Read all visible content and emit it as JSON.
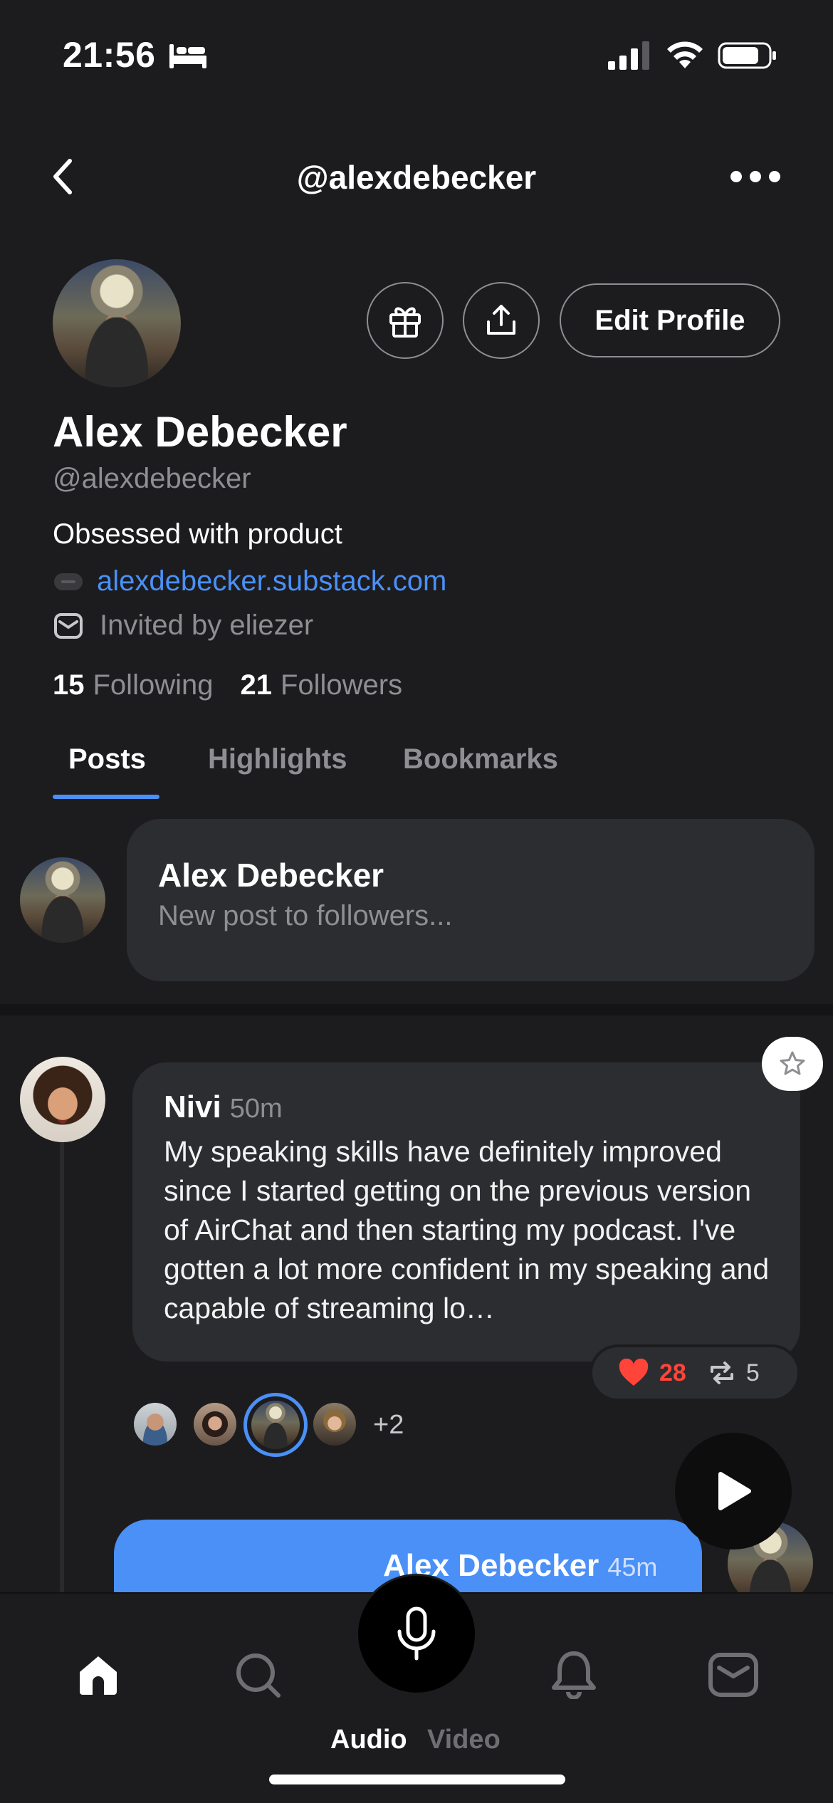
{
  "status_bar": {
    "time": "21:56"
  },
  "header": {
    "title": "@alexdebecker"
  },
  "profile": {
    "edit_label": "Edit Profile",
    "name": "Alex Debecker",
    "handle": "@alexdebecker",
    "bio": "Obsessed with product",
    "link": "alexdebecker.substack.com",
    "invited_by": "Invited by eliezer",
    "following_count": "15",
    "following_label": "Following",
    "followers_count": "21",
    "followers_label": "Followers"
  },
  "tabs": [
    {
      "label": "Posts",
      "active": true
    },
    {
      "label": "Highlights",
      "active": false
    },
    {
      "label": "Bookmarks",
      "active": false
    }
  ],
  "composer": {
    "name": "Alex Debecker",
    "placeholder": "New post to followers..."
  },
  "post": {
    "author": "Nivi",
    "time": "50m",
    "text": "My speaking skills have definitely improved since I started getting on the previous version of AirChat and then starting my podcast. I've gotten a lot more confident in my speaking and capable of streaming lo…",
    "likes": "28",
    "reposts": "5",
    "more_listeners": "+2"
  },
  "next_post": {
    "author": "Alex Debecker",
    "time": "45m"
  },
  "bottom_nav": {
    "audio_label": "Audio",
    "video_label": "Video"
  },
  "colors": {
    "accent": "#4a90f7",
    "like": "#ff453a",
    "background": "#1c1c1e",
    "card": "#2c2d31"
  },
  "icons": [
    "back-icon",
    "more-icon",
    "gift-icon",
    "share-icon",
    "link-icon",
    "mail-icon",
    "star-icon",
    "heart-icon",
    "repost-icon",
    "play-icon",
    "home-icon",
    "search-icon",
    "mic-icon",
    "bell-icon",
    "inbox-icon"
  ]
}
